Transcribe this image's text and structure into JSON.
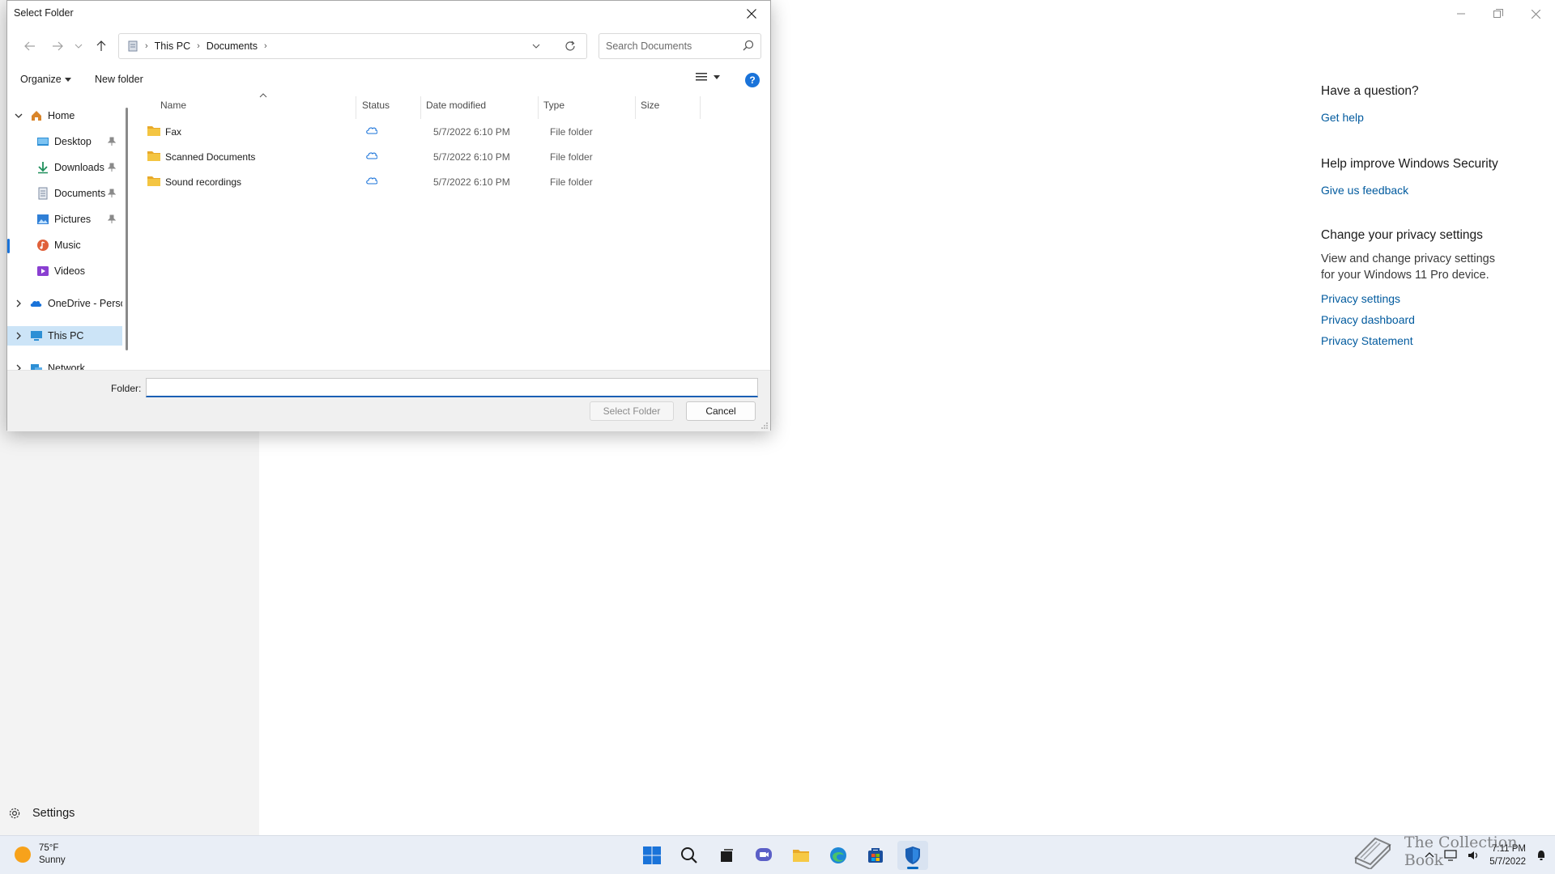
{
  "background_window": {
    "settings_label": "Settings",
    "side_panel": [
      {
        "heading": "Have a question?",
        "text": [],
        "links": [
          "Get help"
        ]
      },
      {
        "heading": "Help improve Windows Security",
        "text": [],
        "links": [
          "Give us feedback"
        ]
      },
      {
        "heading": "Change your privacy settings",
        "text": [
          "View and change privacy settings",
          "for your Windows 11 Pro device."
        ],
        "links": [
          "Privacy settings",
          "Privacy dashboard",
          "Privacy Statement"
        ]
      }
    ]
  },
  "dialog": {
    "title": "Select Folder",
    "breadcrumb": [
      "This PC",
      "Documents"
    ],
    "search_placeholder": "Search Documents",
    "organize_label": "Organize",
    "new_folder_label": "New folder",
    "help_glyph": "?",
    "tree": [
      {
        "label": "Home",
        "icon": "home-icon",
        "color": "#d9852a",
        "expandable": true,
        "expanded": true
      },
      {
        "label": "Desktop",
        "icon": "desktop-icon",
        "color": "#2d8fd5",
        "pinned": true
      },
      {
        "label": "Downloads",
        "icon": "download-icon",
        "color": "#1e8f5b",
        "pinned": true
      },
      {
        "label": "Documents",
        "icon": "document-icon",
        "color": "#7b8aa0",
        "pinned": true
      },
      {
        "label": "Pictures",
        "icon": "pictures-icon",
        "color": "#2f7fd6",
        "pinned": true
      },
      {
        "label": "Music",
        "icon": "music-icon",
        "color": "#e0603a"
      },
      {
        "label": "Videos",
        "icon": "videos-icon",
        "color": "#8a3fd1"
      },
      {
        "label": "OneDrive - Perso",
        "icon": "onedrive-icon",
        "color": "#1a73d9",
        "expandable": true
      },
      {
        "label": "This PC",
        "icon": "pc-icon",
        "color": "#2d8fd5",
        "expandable": true,
        "selected": true
      },
      {
        "label": "Network",
        "icon": "network-icon",
        "color": "#2d8fd5",
        "expandable": true
      }
    ],
    "columns": [
      "Name",
      "Status",
      "Date modified",
      "Type",
      "Size"
    ],
    "files": [
      {
        "name": "Fax",
        "status": "cloud-icon",
        "date": "5/7/2022 6:10 PM",
        "type": "File folder",
        "size": ""
      },
      {
        "name": "Scanned Documents",
        "status": "cloud-icon",
        "date": "5/7/2022 6:10 PM",
        "type": "File folder",
        "size": ""
      },
      {
        "name": "Sound recordings",
        "status": "cloud-icon",
        "date": "5/7/2022 6:10 PM",
        "type": "File folder",
        "size": ""
      }
    ],
    "folder_label": "Folder:",
    "folder_value": "",
    "select_button": "Select Folder",
    "cancel_button": "Cancel"
  },
  "taskbar": {
    "weather_temp": "75°F",
    "weather_desc": "Sunny",
    "apps": [
      "start-icon",
      "search-icon",
      "task-view-icon",
      "chat-icon",
      "file-explorer-icon",
      "edge-icon",
      "store-icon",
      "windows-security-icon"
    ],
    "active_app": "windows-security-icon",
    "time": "7:11 PM",
    "date": "5/7/2022",
    "watermark_text": "The Collection Book"
  },
  "colors": {
    "accent": "#1a73d9",
    "link": "#005a9e",
    "selection": "#cce4f7",
    "taskbar": "#e9eef6",
    "folder_yellow": "#f4c542"
  }
}
